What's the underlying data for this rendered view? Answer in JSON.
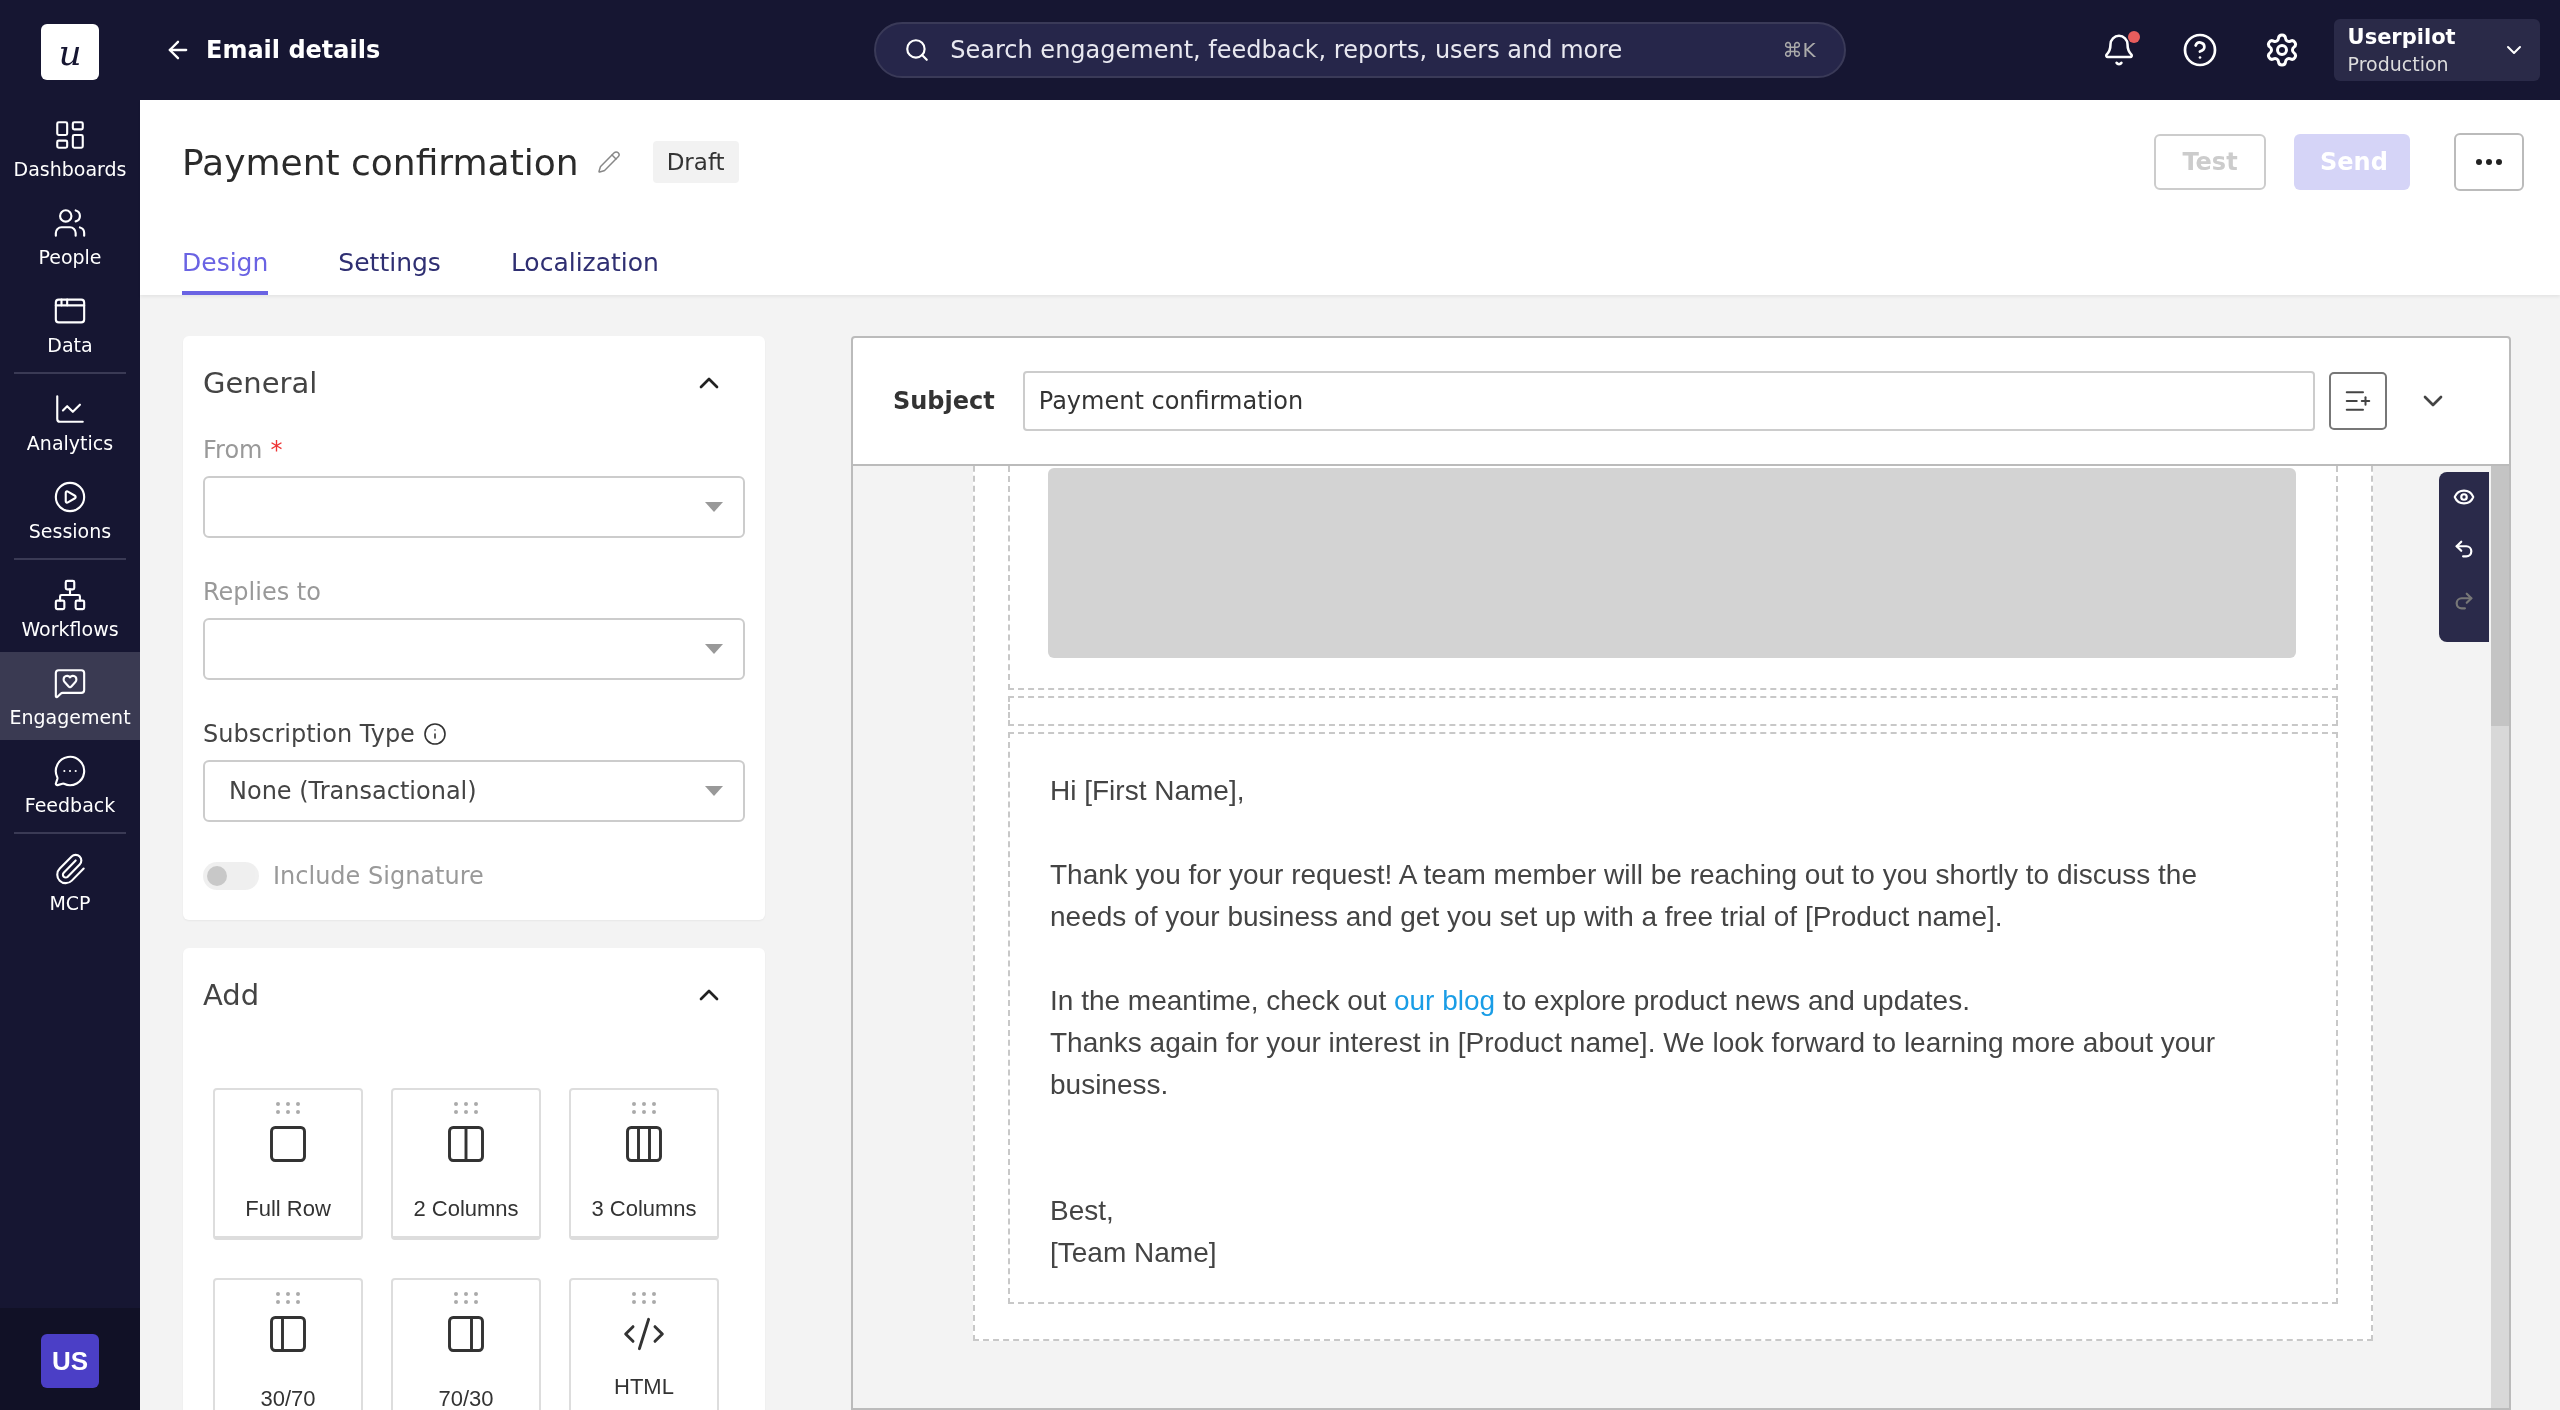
{
  "topbar": {
    "back_label": "Email details",
    "search": {
      "placeholder": "Search engagement, feedback, reports, users and more",
      "shortcut": "⌘K"
    },
    "notifications": {
      "unread": true
    },
    "workspace": {
      "name": "Userpilot",
      "environment": "Production"
    }
  },
  "sidebar": {
    "logo": "u",
    "groups": [
      {
        "items": [
          {
            "label": "Dashboards",
            "selected": false
          },
          {
            "label": "People",
            "selected": false
          },
          {
            "label": "Data",
            "selected": false
          }
        ]
      },
      {
        "items": [
          {
            "label": "Analytics",
            "selected": false
          },
          {
            "label": "Sessions",
            "selected": false
          }
        ]
      },
      {
        "items": [
          {
            "label": "Workflows",
            "selected": false
          },
          {
            "label": "Engagement",
            "selected": true
          },
          {
            "label": "Feedback",
            "selected": false
          }
        ]
      },
      {
        "items": [
          {
            "label": "MCP",
            "selected": false
          }
        ]
      }
    ],
    "user_initials": "US"
  },
  "header": {
    "title": "Payment confirmation",
    "status": "Draft",
    "actions": [
      {
        "label": "Test",
        "kind": "outline",
        "disabled": true
      },
      {
        "label": "Send",
        "kind": "primary",
        "disabled": true
      }
    ]
  },
  "tabs": [
    {
      "label": "Design",
      "selected": true
    },
    {
      "label": "Settings",
      "selected": false
    },
    {
      "label": "Localization",
      "selected": false
    }
  ],
  "general": {
    "title": "General",
    "expanded": true,
    "fields": [
      {
        "label": "From",
        "required_mark": "*"
      },
      {
        "label": "Replies to"
      }
    ],
    "subscription": {
      "label": "Subscription Type",
      "value": "None (Transactional)"
    },
    "signature": {
      "label": "Include Signature",
      "on": false,
      "disabled": true
    }
  },
  "add": {
    "title": "Add",
    "expanded": true,
    "blocks": [
      {
        "label": "Full Row"
      },
      {
        "label": "2 Columns"
      },
      {
        "label": "3 Columns"
      },
      {
        "label": "30/70"
      },
      {
        "label": "70/30"
      },
      {
        "label": "HTML"
      }
    ]
  },
  "editor": {
    "subject": {
      "label": "Subject",
      "value": "Payment confirmation"
    },
    "toolbar": [
      {
        "kind": "preview",
        "disabled": false
      },
      {
        "kind": "undo",
        "disabled": false
      },
      {
        "kind": "redo",
        "disabled": true
      }
    ],
    "body": [
      {
        "kind": "text",
        "lines": [
          {
            "text": "Hi [First Name],"
          }
        ]
      },
      {
        "kind": "text",
        "lines": [
          {
            "text": "Thank you for your request! A team member will be reaching out to you shortly to discuss the needs of your business and get you set up with a free trial of [Product name]."
          }
        ]
      },
      {
        "kind": "text",
        "lines": [
          {
            "text": "In the meantime, check out ",
            "link": "our blog",
            "after": " to explore product news and updates."
          },
          {
            "text": "Thanks again for your interest in [Product name]. We look forward to learning more about your business."
          }
        ]
      },
      {
        "kind": "signoff",
        "lines": [
          {
            "text": "Best,"
          },
          {
            "text": "[Team Name]"
          }
        ]
      }
    ]
  }
}
